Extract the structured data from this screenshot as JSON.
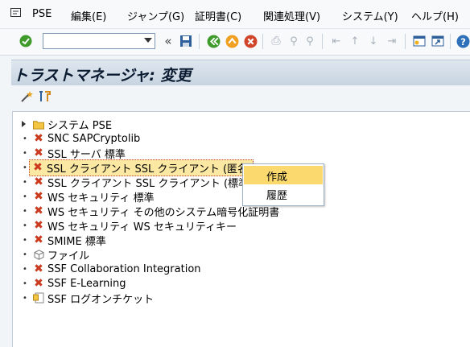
{
  "menubar": {
    "items": [
      "PSE",
      "編集(E)",
      "ジャンプ(G)",
      "証明書(C)",
      "関連処理(V)",
      "システム(Y)",
      "ヘルプ(H)"
    ]
  },
  "toolbar": {
    "command_value": "",
    "icons": [
      "enter-icon",
      "command-dropdown-icon",
      "collapse-icon",
      "save-icon",
      "back-icon",
      "exit-icon",
      "cancel-icon",
      "print-icon",
      "find-icon",
      "find-next-icon",
      "first-page-icon",
      "previous-page-icon",
      "next-page-icon",
      "last-page-icon",
      "create-session-icon",
      "shortcut-icon",
      "help-icon"
    ]
  },
  "title": "トラストマネージャ: 変更",
  "app_toolbar": {
    "icons": [
      "wizard-icon",
      "tools-icon"
    ]
  },
  "tree": {
    "items": [
      {
        "label": "システム PSE",
        "icon": "folder-icon",
        "marker": "expand-arrow"
      },
      {
        "label": "SNC SAPCryptolib",
        "icon": "x-icon",
        "marker": "bullet"
      },
      {
        "label": "SSL サーバ 標準",
        "icon": "x-icon",
        "marker": "bullet"
      },
      {
        "label": "SSL クライアント SSL クライアント (匿名)",
        "icon": "x-icon",
        "marker": "bullet",
        "selected": true
      },
      {
        "label": "SSL クライアント SSL クライアント (標準)",
        "icon": "x-icon",
        "marker": "bullet"
      },
      {
        "label": "WS セキュリティ 標準",
        "icon": "x-icon",
        "marker": "bullet"
      },
      {
        "label": "WS セキュリティ その他のシステム暗号化証明書",
        "icon": "x-icon",
        "marker": "bullet"
      },
      {
        "label": "WS セキュリティ WS セキュリティキー",
        "icon": "x-icon",
        "marker": "bullet"
      },
      {
        "label": "SMIME 標準",
        "icon": "x-icon",
        "marker": "bullet"
      },
      {
        "label": "ファイル",
        "icon": "cube-icon",
        "marker": "bullet"
      },
      {
        "label": "SSF Collaboration Integration",
        "icon": "x-icon",
        "marker": "bullet"
      },
      {
        "label": "SSF E-Learning",
        "icon": "x-icon",
        "marker": "bullet"
      },
      {
        "label": "SSF ログオンチケット",
        "icon": "ticket-icon",
        "marker": "bullet"
      }
    ]
  },
  "context_menu": {
    "items": [
      {
        "label": "作成",
        "highlighted": true
      },
      {
        "label": "履歴",
        "highlighted": false
      }
    ]
  }
}
